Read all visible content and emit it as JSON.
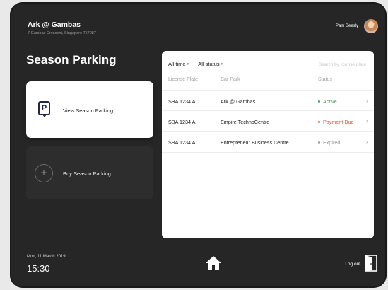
{
  "header": {
    "location_title": "Ark @ Gambas",
    "address": "7 Gambas Crescent, Singapore 757087",
    "user_name": "Pam Beesly"
  },
  "page_title": "Season Parking",
  "actions": {
    "view_label": "View Season Parking",
    "buy_label": "Buy Season Parking"
  },
  "table": {
    "filters": [
      {
        "label": "All time"
      },
      {
        "label": "All status"
      }
    ],
    "search_placeholder": "Search by license plate",
    "columns": [
      "License Plate",
      "Car Park",
      "Status"
    ],
    "rows": [
      {
        "plate": "SBA 1234 A",
        "car_park": "Ark @ Gambas",
        "status": "Active",
        "status_color": "#3aa35a"
      },
      {
        "plate": "SBA 1234 A",
        "car_park": "Empire TechnoCentre",
        "status": "Payment Due",
        "status_color": "#d9534f"
      },
      {
        "plate": "SBA 1234 A",
        "car_park": "Entrepreneur Business Centre",
        "status": "Expired",
        "status_color": "#9a9a9a"
      }
    ]
  },
  "footer": {
    "date": "Mon, 11 March 2019",
    "time": "15:30",
    "logout_label": "Log out"
  },
  "icons": {
    "parking": "P",
    "plus": "+",
    "chevron": "›",
    "caret": "▾"
  }
}
